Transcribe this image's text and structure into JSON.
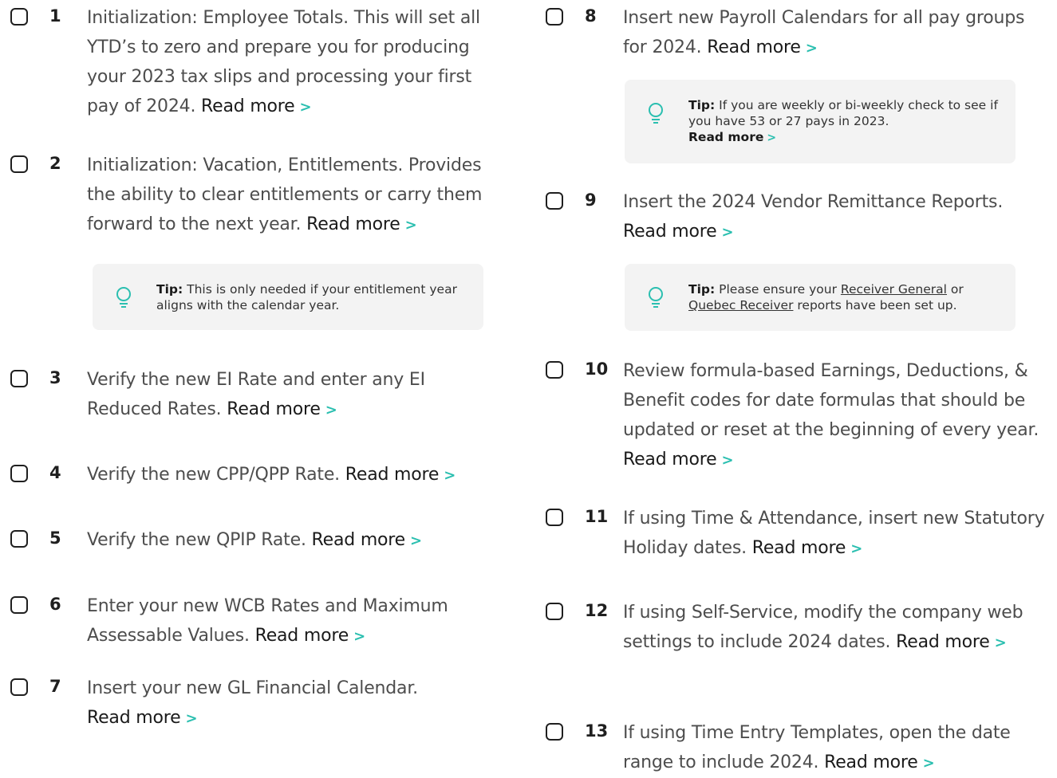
{
  "read_more": "Read more",
  "chevron": ">",
  "left": {
    "items": [
      {
        "num": "1",
        "text": "Initialization: Employee Totals. This will set all YTD’s to zero and prepare you for producing your 2023 tax slips and processing your first pay of 2024."
      },
      {
        "num": "2",
        "text": "Initialization: Vacation, Entitlements. Provides the ability to clear entitlements or carry them forward to the next year."
      },
      {
        "num": "3",
        "text": "Verify the new EI Rate and enter any EI Reduced Rates."
      },
      {
        "num": "4",
        "text": "Verify the new CPP/QPP Rate."
      },
      {
        "num": "5",
        "text": "Verify the new QPIP Rate."
      },
      {
        "num": "6",
        "text": "Enter your new WCB Rates and Maximum Assessable Values."
      },
      {
        "num": "7",
        "text": "Insert your new GL Financial Calendar."
      }
    ],
    "tip2": {
      "label": "Tip:",
      "text": "This is only needed if your entitlement year aligns with the calendar year."
    }
  },
  "right": {
    "items": [
      {
        "num": "8",
        "text": "Insert new Payroll Calendars for all pay groups for 2024."
      },
      {
        "num": "9",
        "text": "Insert the 2024 Vendor Remittance Reports."
      },
      {
        "num": "10",
        "text": "Review formula-based Earnings, Deductions, & Benefit codes for date formulas that should be updated or reset at the beginning of every year."
      },
      {
        "num": "11",
        "text": "If using Time & Attendance, insert new Statutory Holiday dates."
      },
      {
        "num": "12",
        "text": "If using Self-Service, modify the company web settings to include 2024 dates."
      },
      {
        "num": "13",
        "text": "If using Time Entry Templates, open the date range to include 2024."
      }
    ],
    "tip8": {
      "label": "Tip:",
      "text": "If you are weekly or bi-weekly check to see if you have 53 or 27 pays in 2023.",
      "read_more": "Read more"
    },
    "tip9": {
      "label": "Tip:",
      "pre": "Please ensure your",
      "link1": "Receiver General",
      "mid": "or",
      "link2": "Quebec Receiver",
      "post": "reports have been set up."
    }
  }
}
